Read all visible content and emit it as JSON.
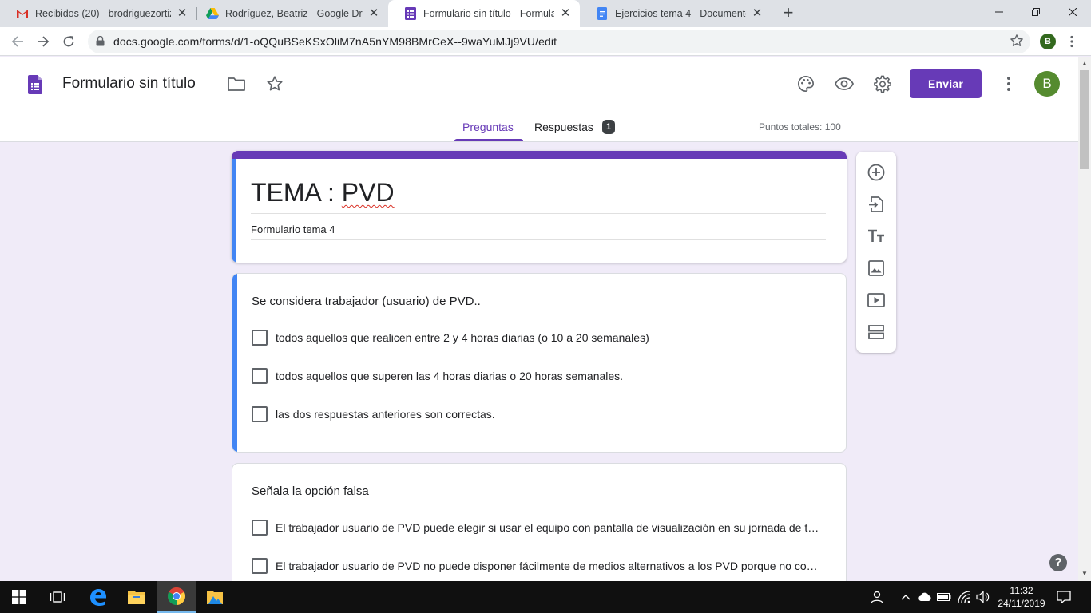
{
  "browser": {
    "tabs": [
      {
        "title": "Recibidos (20) - brodriguezortiz4",
        "icon": "gmail-icon"
      },
      {
        "title": "Rodríguez, Beatriz - Google Drive",
        "icon": "google-drive-icon"
      },
      {
        "title": "Formulario sin título - Formulario",
        "icon": "google-forms-icon",
        "active": true
      },
      {
        "title": "Ejercicios tema 4 - Documentos d",
        "icon": "google-docs-icon"
      }
    ],
    "url": "docs.google.com/forms/d/1-oQQuBSeKSxOliM7nA5nYM98BMrCeX--9waYuMJj9VU/edit",
    "profile_initial": "B"
  },
  "forms_header": {
    "doc_title": "Formulario sin título",
    "send_label": "Enviar",
    "avatar_initial": "B",
    "tab_questions": "Preguntas",
    "tab_responses": "Respuestas",
    "responses_count": "1",
    "points": "Puntos totales: 100"
  },
  "form": {
    "title_prefix": "TEMA : ",
    "title_word": "PVD",
    "description": "Formulario tema 4"
  },
  "questions": [
    {
      "title": "Se considera trabajador (usuario) de PVD..",
      "options": [
        "todos aquellos que realicen entre 2 y 4 horas diarias (o 10 a 20 semanales)",
        "todos aquellos que superen las 4 horas diarias o 20 horas semanales.",
        "las dos respuestas anteriores son correctas."
      ]
    },
    {
      "title": "Señala la opción falsa",
      "options": [
        "El trabajador usuario de PVD puede elegir si usar el equipo con pantalla de visualización en su jornada de t…",
        "El trabajador usuario de PVD no puede disponer fácilmente de medios alternativos a los PVD porque no co…"
      ]
    }
  ],
  "taskbar": {
    "time": "11:32",
    "date": "24/11/2019"
  },
  "colors": {
    "accent": "#673ab7",
    "background": "#f0ebf8",
    "active_question_bar": "#4285f4"
  }
}
